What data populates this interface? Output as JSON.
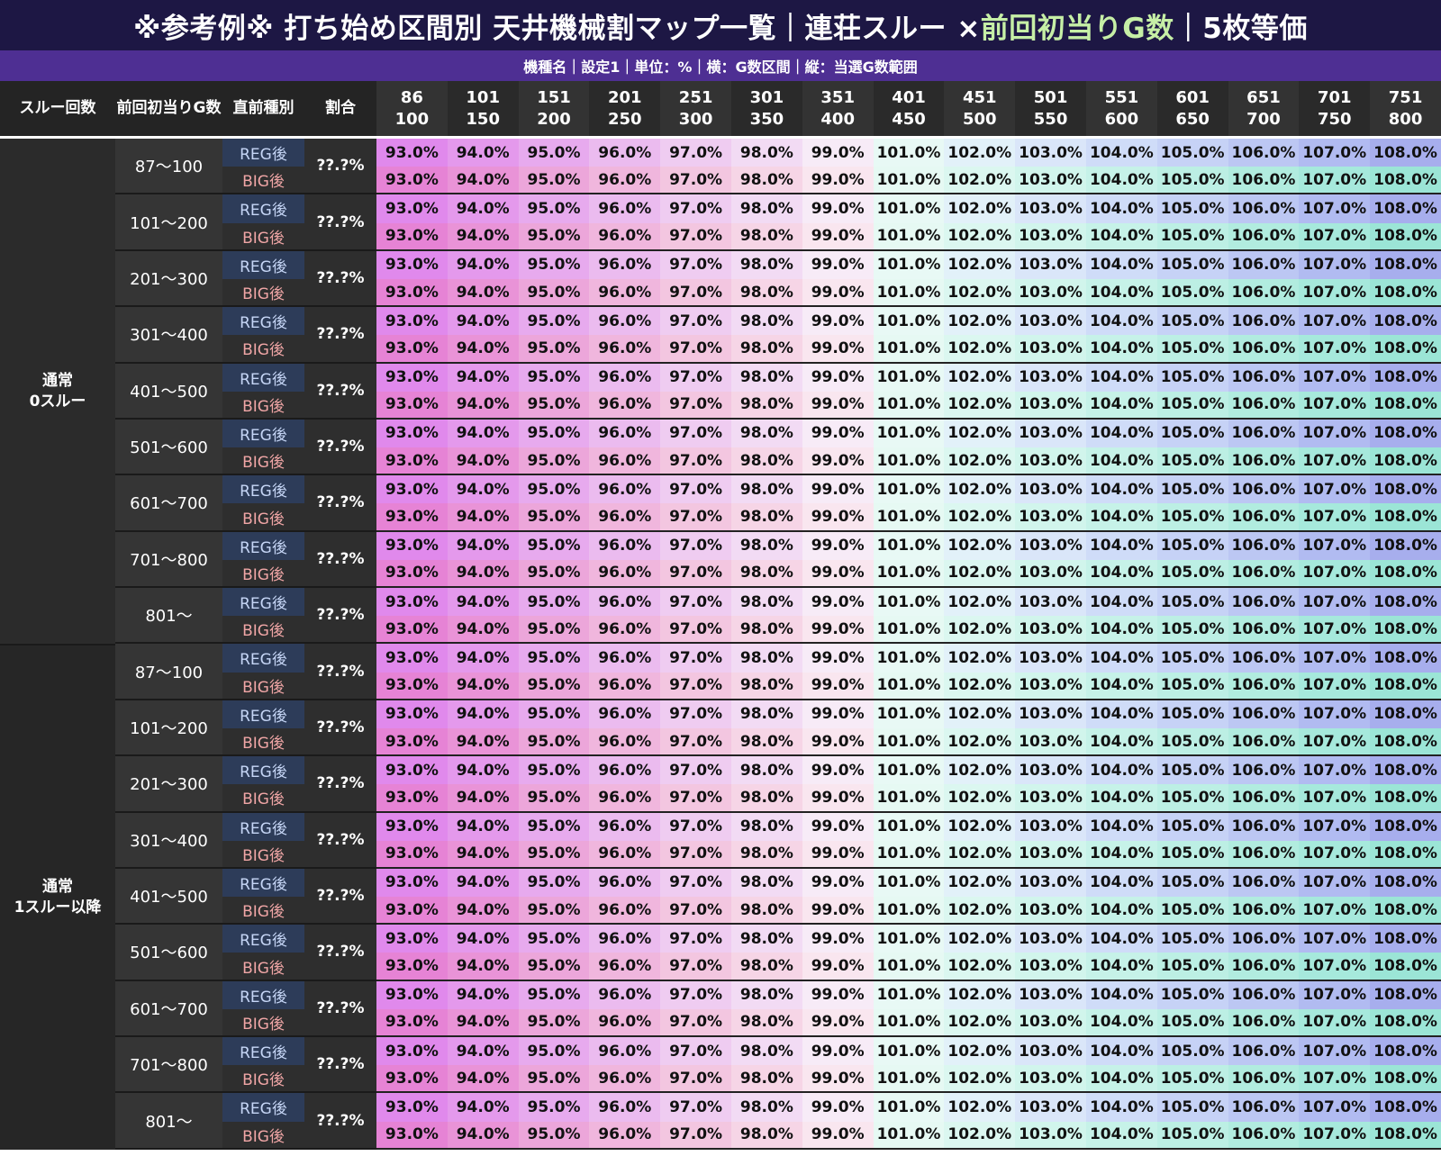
{
  "title": {
    "prefix": "※参考例※ 打ち始め区間別 天井機械割マップ一覧｜連荘スルー ×",
    "accent": "前回初当りG数",
    "suffix": "｜5枚等価"
  },
  "subtitle": "機種名｜設定1｜単位：%｜横：G数区間｜縦：当選G数範囲",
  "headers": {
    "through": "スルー回数",
    "prev_hit_line1": "前回",
    "prev_hit_line2": "初当りG数",
    "last_type_line1": "直前",
    "last_type_line2": "種別",
    "ratio": "割合"
  },
  "ranges": [
    {
      "start": "86",
      "end": "100"
    },
    {
      "start": "101",
      "end": "150"
    },
    {
      "start": "151",
      "end": "200"
    },
    {
      "start": "201",
      "end": "250"
    },
    {
      "start": "251",
      "end": "300"
    },
    {
      "start": "301",
      "end": "350"
    },
    {
      "start": "351",
      "end": "400"
    },
    {
      "start": "401",
      "end": "450"
    },
    {
      "start": "451",
      "end": "500"
    },
    {
      "start": "501",
      "end": "550"
    },
    {
      "start": "551",
      "end": "600"
    },
    {
      "start": "601",
      "end": "650"
    },
    {
      "start": "651",
      "end": "700"
    },
    {
      "start": "701",
      "end": "750"
    },
    {
      "start": "751",
      "end": "800"
    }
  ],
  "groups": [
    {
      "line1": "通常",
      "line2": "0スルー"
    },
    {
      "line1": "通常",
      "line2": "1スルー以降"
    }
  ],
  "buckets": [
    "87〜100",
    "101〜200",
    "201〜300",
    "301〜400",
    "401〜500",
    "501〜600",
    "601〜700",
    "701〜800",
    "801〜"
  ],
  "types": {
    "reg": "REG後",
    "big": "BIG後"
  },
  "ratio_placeholder": "??.?%",
  "values": [
    "93.0%",
    "94.0%",
    "95.0%",
    "96.0%",
    "97.0%",
    "98.0%",
    "99.0%",
    "101.0%",
    "102.0%",
    "103.0%",
    "104.0%",
    "105.0%",
    "106.0%",
    "107.0%",
    "108.0%"
  ],
  "colors": {
    "reg_row": [
      "#e089ec",
      "#e499ec",
      "#e7aaee",
      "#ebbbef",
      "#efccf1",
      "#f2dbf4",
      "#f7ebf7",
      "#e8f9f5",
      "#e2f1f9",
      "#dae6f9",
      "#cfdcf8",
      "#c6d2f6",
      "#bcc7f3",
      "#b1bbf1",
      "#a7aeed"
    ],
    "big_row": [
      "#e683d5",
      "#e993d7",
      "#eca6da",
      "#f0b6dd",
      "#f3c6e0",
      "#f6d5e6",
      "#f9e6ef",
      "#e6f9f3",
      "#dbf7f0",
      "#d1f5ec",
      "#c6f2e8",
      "#bcefe4",
      "#b1ecdf",
      "#a6e9dc",
      "#9be5d6"
    ]
  }
}
